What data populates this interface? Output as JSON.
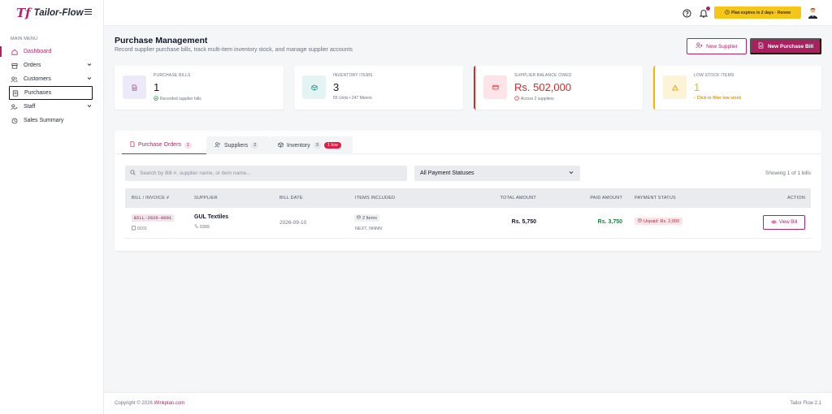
{
  "brand": {
    "mark": "Tf",
    "name": "Tailor-Flow"
  },
  "sidebar": {
    "title": "MAIN MENU",
    "items": [
      {
        "label": "Dashboard",
        "icon": "home-icon"
      },
      {
        "label": "Orders",
        "icon": "orders-icon"
      },
      {
        "label": "Customers",
        "icon": "users-icon"
      },
      {
        "label": "Purchases",
        "icon": "purchases-icon"
      },
      {
        "label": "Staff",
        "icon": "staff-icon"
      },
      {
        "label": "Sales Summary",
        "icon": "clock-icon"
      }
    ]
  },
  "topbar": {
    "plan_badge": "Plan expires in 2 days · Renew"
  },
  "page": {
    "title": "Purchase Management",
    "subtitle": "Record supplier purchase bills, track multi-item inventory stock, and manage supplier accounts",
    "new_supplier_label": "New Supplier",
    "new_bill_label": "New Purchase Bill"
  },
  "stats": {
    "bills": {
      "label": "PURCHASE BILLS",
      "value": "1",
      "note": "Recorded supplier bills"
    },
    "inventory": {
      "label": "INVENTORY ITEMS",
      "value": "3",
      "note": "55 Units • 247 Meters"
    },
    "balance": {
      "label": "SUPPLIER BALANCE OWED",
      "value": "Rs. 502,000",
      "note": "Across 2 suppliers"
    },
    "low": {
      "label": "LOW STOCK ITEMS",
      "value": "1",
      "note": "Click to filter low stock"
    }
  },
  "tabs": {
    "orders": {
      "label": "Purchase Orders",
      "count": "1"
    },
    "suppliers": {
      "label": "Suppliers",
      "count": "2"
    },
    "inventory": {
      "label": "Inventory",
      "count": "3",
      "low": "1 low"
    }
  },
  "filters": {
    "search_placeholder": "Search by Bill #, supplier name, or item name...",
    "status_selected": "All Payment Statuses",
    "showing": "Showing 1 of 1 bills"
  },
  "table": {
    "headers": {
      "bill": "BILL / INVOICE #",
      "supplier": "SUPPLIER",
      "date": "BILL DATE",
      "items": "ITEMS INCLUDED",
      "total": "TOTAL AMOUNT",
      "paid": "PAID AMOUNT",
      "status": "PAYMENT STATUS",
      "action": "ACTION"
    },
    "rows": [
      {
        "bill": "BILL-2026-0001",
        "bill_ref": "0101",
        "supplier": "GUL Textiles",
        "supplier_phone": "0365",
        "date": "2026-09-10",
        "items_count": "2 Items",
        "items_names": "NEXT, NNNN",
        "total": "Rs. 5,750",
        "paid": "Rs. 3,750",
        "status": "Unpaid: Rs. 2,000",
        "action": "View Bill"
      }
    ]
  },
  "footer": {
    "copyright": "Copyright © 2026",
    "company": "Winkplan.com",
    "version": "Tailor Flow 2.1"
  },
  "colors": {
    "brand": "#b0236b",
    "warning": "#f5c518",
    "danger": "#dc2626",
    "success": "#15803d"
  }
}
